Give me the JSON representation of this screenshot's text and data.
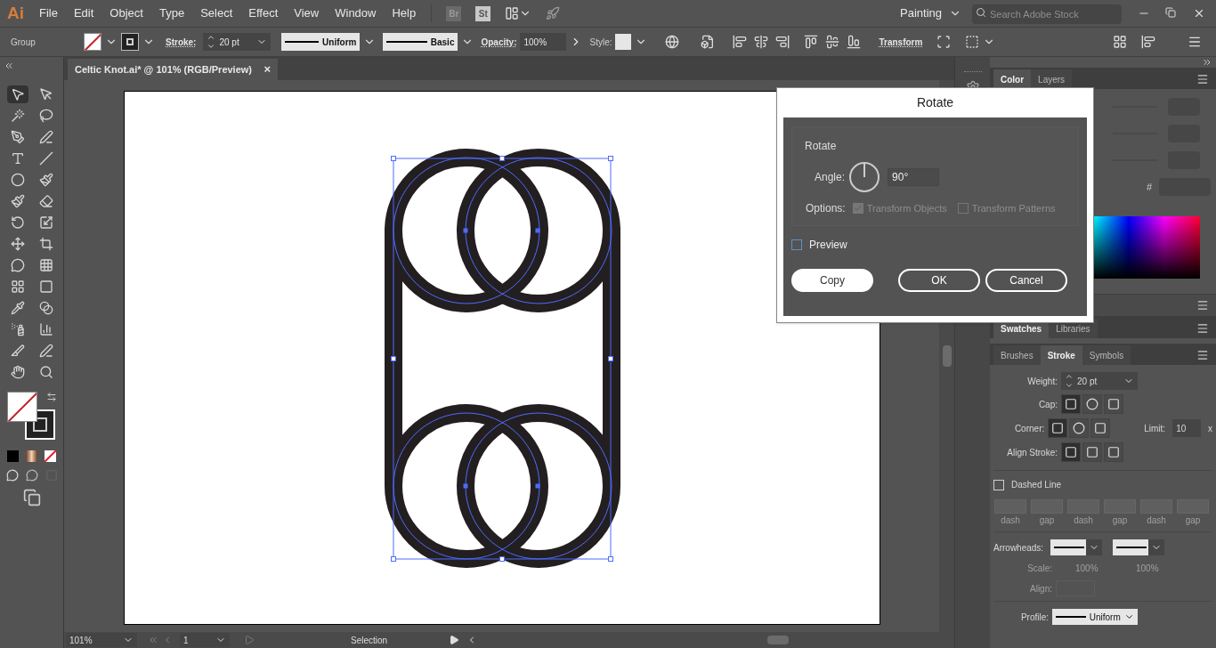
{
  "menu_bar": {
    "logo": "Ai",
    "menus": [
      "File",
      "Edit",
      "Object",
      "Type",
      "Select",
      "Effect",
      "View",
      "Window",
      "Help"
    ],
    "bridge": "Br",
    "stock": "St",
    "workspace": "Painting",
    "search": {
      "placeholder": "Search Adobe Stock"
    }
  },
  "control_bar": {
    "selection": "Group",
    "stroke_label": "Stroke:",
    "stroke_weight": "20 pt",
    "profile": "Uniform",
    "brush": "Basic",
    "opacity_label": "Opacity:",
    "opacity": "100%",
    "style_label": "Style:",
    "transform": "Transform"
  },
  "document_tab": {
    "title": "Celtic Knot.ai* @ 101% (RGB/Preview)",
    "close": "×"
  },
  "color_tabs": [
    {
      "label": "Color",
      "selected": true
    },
    {
      "label": "Layers",
      "selected": false
    }
  ],
  "color_panel": {
    "hex_label": "#"
  },
  "swatch_tabs": [
    {
      "label": "Swatches",
      "selected": true
    },
    {
      "label": "Libraries",
      "selected": false
    }
  ],
  "stroke_tabs": [
    {
      "label": "Brushes",
      "selected": false
    },
    {
      "label": "Stroke",
      "selected": true
    },
    {
      "label": "Symbols",
      "selected": false
    }
  ],
  "stroke_panel": {
    "weight_label": "Weight:",
    "weight": "20 pt",
    "cap_label": "Cap:",
    "caps": [
      {
        "selected": true
      },
      {
        "selected": false
      },
      {
        "selected": false
      }
    ],
    "corner_label": "Corner:",
    "corners": [
      {
        "selected": true
      },
      {
        "selected": false
      },
      {
        "selected": false
      }
    ],
    "limit_label": "Limit:",
    "limit": "10",
    "limit_unit": "x",
    "align_label": "Align Stroke:",
    "aligns": [
      {
        "selected": true
      },
      {
        "selected": false
      },
      {
        "selected": false
      }
    ],
    "dashed": {
      "label": "Dashed Line",
      "checked": false
    },
    "dash_fields": [
      {
        "label": "dash"
      },
      {
        "label": "gap"
      },
      {
        "label": "dash"
      },
      {
        "label": "gap"
      },
      {
        "label": "dash"
      },
      {
        "label": "gap"
      }
    ],
    "arrowheads_label": "Arrowheads:",
    "scale_label": "Scale:",
    "scales": [
      "100%",
      "100%"
    ],
    "arrow_align_label": "Align:",
    "profile_label": "Profile:",
    "profile": "Uniform"
  },
  "dialog": {
    "title": "Rotate",
    "group_label": "Rotate",
    "angle_label": "Angle:",
    "angle": "90°",
    "options_label": "Options:",
    "options": [
      {
        "label": "Transform Objects",
        "checked": true,
        "disabled": true
      },
      {
        "label": "Transform Patterns",
        "checked": false,
        "disabled": true
      }
    ],
    "preview": {
      "label": "Preview",
      "checked": false
    },
    "buttons": [
      {
        "label": "Copy",
        "kind": "filled"
      },
      {
        "label": "OK",
        "kind": "outline"
      },
      {
        "label": "Cancel",
        "kind": "outline"
      }
    ]
  },
  "status_bar": {
    "zoom": "101%",
    "artboard": "1",
    "tool": "Selection"
  }
}
